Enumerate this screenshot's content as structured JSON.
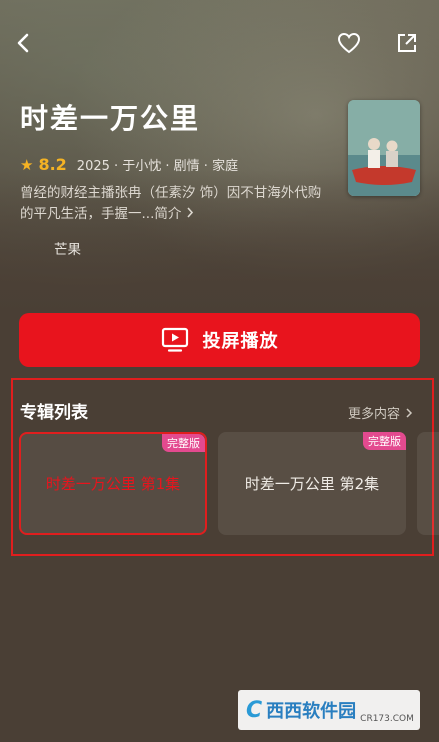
{
  "show": {
    "title": "时差一万公里",
    "rating": "8.2",
    "meta": "2025 · 于小忱 · 剧情 · 家庭",
    "description": "曾经的财经主播张冉（任素汐 饰）因不甘海外代购的平凡生活，手握一...",
    "more_link": "简介",
    "platform": "芒果"
  },
  "actions": {
    "cast_label": "投屏播放"
  },
  "album": {
    "title": "专辑列表",
    "more_label": "更多内容",
    "episodes": [
      {
        "label": "时差一万公里 第1集",
        "badge": "完整版",
        "active": true
      },
      {
        "label": "时差一万公里 第2集",
        "badge": "完整版",
        "active": false
      }
    ]
  },
  "icons": {
    "back": "back-arrow-icon",
    "favorite": "heart-icon",
    "share": "share-icon",
    "cast": "tv-play-icon",
    "rating": "star-icon",
    "more": "chevron-right-icon"
  },
  "colors": {
    "accent": "#e8141d",
    "rating": "#f5b324",
    "badge": "#e34a8f"
  },
  "watermark": {
    "name": "西西软件园",
    "domain": "CR173.COM"
  }
}
